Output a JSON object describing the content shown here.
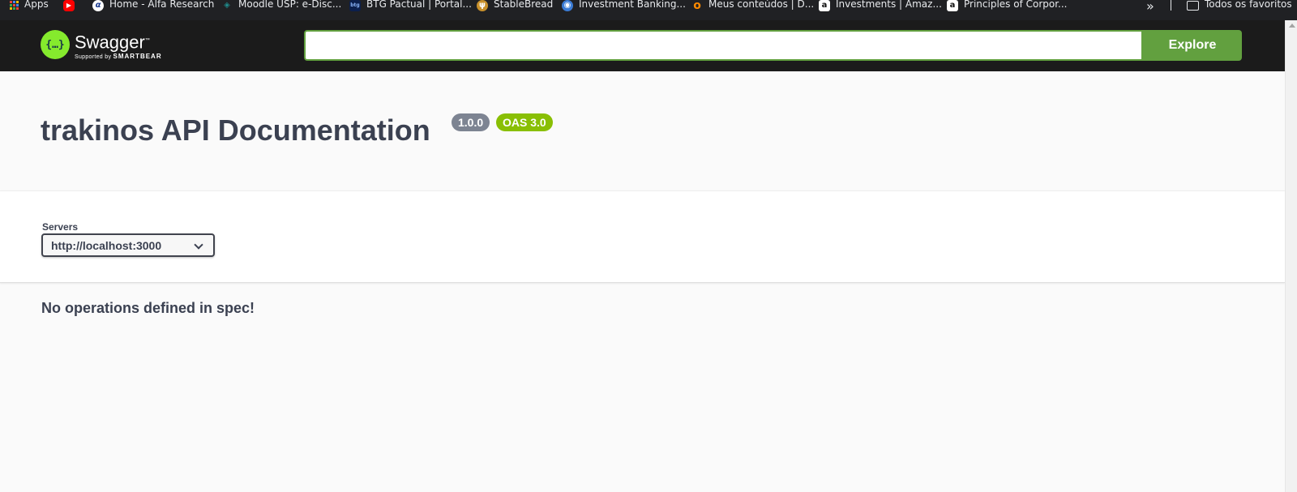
{
  "bookmarks": {
    "items": [
      {
        "label": "Apps",
        "icon": "apps-icon"
      },
      {
        "label": "",
        "icon": "youtube-icon",
        "color": "#ff0000"
      },
      {
        "label": "Home - Alfa Research",
        "icon": "alfa-icon",
        "color": "#1a3a8f"
      },
      {
        "label": "Moodle USP: e-Disc...",
        "icon": "moodle-icon",
        "color": "#1f8a8a"
      },
      {
        "label": "BTG Pactual | Portal...",
        "icon": "btg-icon",
        "color": "#0b1f4d"
      },
      {
        "label": "StableBread",
        "icon": "stablebread-icon",
        "color": "#c8902b"
      },
      {
        "label": "Investment Banking...",
        "icon": "globe-icon",
        "color": "#3a7bd5"
      },
      {
        "label": "Meus conteúdos | D...",
        "icon": "orange-circle-icon",
        "color": "#ff8a00"
      },
      {
        "label": "Investments | Amaz...",
        "icon": "amazon-icon",
        "color": "#ffffff"
      },
      {
        "label": "Principles of Corpor...",
        "icon": "amazon-icon",
        "color": "#ffffff"
      }
    ],
    "more_label": "»",
    "all_bookmarks_label": "Todos os favoritos"
  },
  "topbar": {
    "logo_name": "Swagger",
    "logo_tm": "™",
    "logo_sub_prefix": "Supported by",
    "logo_sub_brand": "SMARTBEAR",
    "logo_glyph": "{…}",
    "search_value": "",
    "explore_label": "Explore",
    "accent_color": "#62a03f"
  },
  "info": {
    "title": "trakinos API Documentation",
    "version_badge": "1.0.0",
    "oas_badge": "OAS 3.0"
  },
  "servers": {
    "label": "Servers",
    "selected": "http://localhost:3000"
  },
  "operations": {
    "empty_message": "No operations defined in spec!"
  }
}
